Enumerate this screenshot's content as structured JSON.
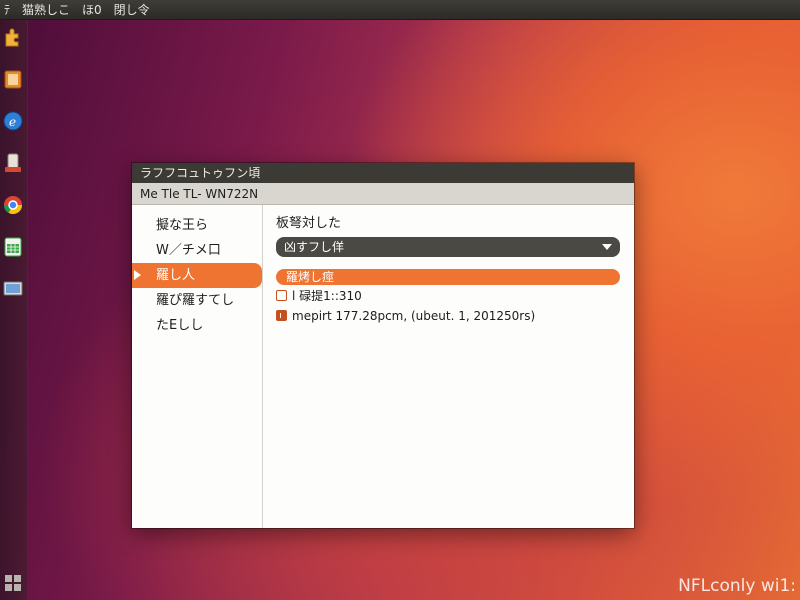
{
  "top_panel": {
    "menu": [
      "ﾃ",
      "猫熟しこ",
      "ほ0",
      "閉し令"
    ]
  },
  "launcher": {
    "icons": [
      {
        "name": "puzzle-icon",
        "color": "#f3b23a"
      },
      {
        "name": "archive-icon",
        "color": "#e8892c"
      },
      {
        "name": "browser-icon",
        "color": "#2f7fd6"
      },
      {
        "name": "installer-icon",
        "color": "#e9e2d6"
      },
      {
        "name": "chrome-icon",
        "color": "#4caf50"
      },
      {
        "name": "spreadsheet-icon",
        "color": "#3aa54a"
      },
      {
        "name": "screen-icon",
        "color": "#6fa0d8"
      },
      {
        "name": "workspace-icon",
        "color": "#b9b3ad"
      }
    ]
  },
  "dialog": {
    "title": "ラフフコュトゥフン頃",
    "subtitle": "Me  Tle  TL- WN722N",
    "sidebar": {
      "items": [
        {
          "label": "擬な王ら"
        },
        {
          "label": "W／チメ口"
        },
        {
          "label": "羅し人"
        },
        {
          "label": "羅ぴ羅すてし"
        },
        {
          "label": "たЕしし"
        }
      ]
    },
    "content": {
      "heading": "板弩対した",
      "combo_value": "凶すフし佯",
      "section_label": "羅烤し痙",
      "rows": [
        {
          "text": "l 碌提1::310"
        },
        {
          "text": "mepirt 177.28pcm, (ubeut. 1, 201250rs)"
        }
      ]
    }
  },
  "watermark": "NFLconly wi1:",
  "colors": {
    "accent": "#ef7431",
    "panel": "#3b3a35"
  }
}
